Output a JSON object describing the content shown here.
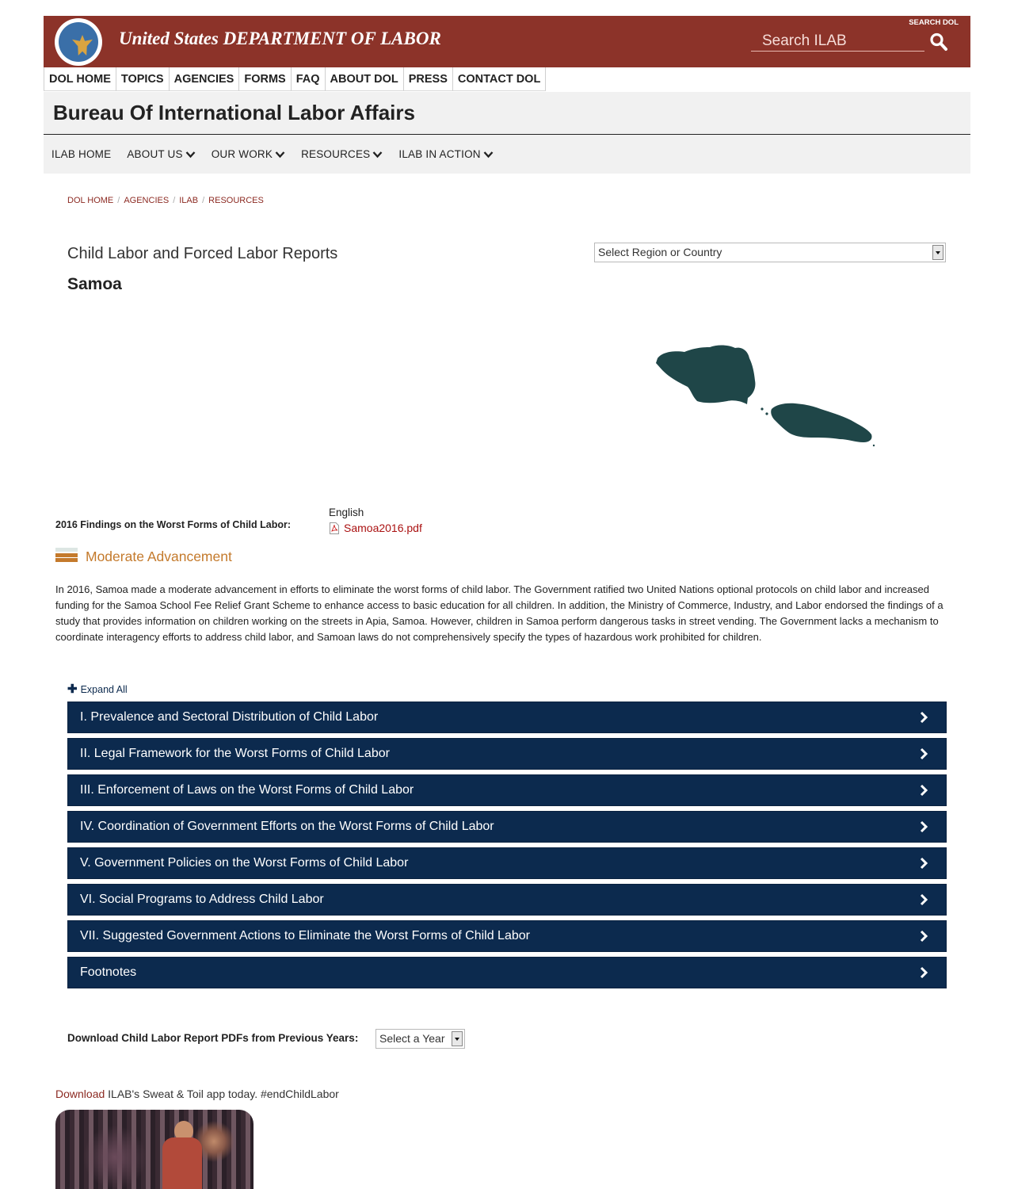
{
  "header": {
    "agency_name": "United States DEPARTMENT OF LABOR",
    "search_dol_label": "SEARCH DOL",
    "search_placeholder": "Search ILAB",
    "brand_color": "#8c3329"
  },
  "top_nav": [
    "DOL HOME",
    "TOPICS",
    "AGENCIES",
    "FORMS",
    "FAQ",
    "ABOUT DOL",
    "PRESS",
    "CONTACT DOL"
  ],
  "bureau_title": "Bureau Of International Labor Affairs",
  "sub_nav": [
    "ILAB HOME",
    "ABOUT US",
    "OUR WORK",
    "RESOURCES",
    "ILAB IN ACTION"
  ],
  "breadcrumb": [
    "DOL HOME",
    "AGENCIES",
    "ILAB",
    "RESOURCES"
  ],
  "page": {
    "title": "Child Labor and Forced Labor Reports",
    "country": "Samoa",
    "region_select": "Select Region or Country",
    "map_color": "#1f4648"
  },
  "findings": {
    "label": "2016 Findings on the Worst Forms of Child Labor:",
    "language": "English",
    "pdf_name": "Samoa2016.pdf"
  },
  "assessment": {
    "label": "Moderate Advancement",
    "color": "#c47a2c"
  },
  "summary": "In 2016, Samoa made a moderate advancement in efforts to eliminate the worst forms of child labor. The Government ratified two United Nations optional protocols on child labor and increased funding for the Samoa School Fee Relief Grant Scheme to enhance access to basic education for all children. In addition, the Ministry of Commerce, Industry, and Labor endorsed the findings of a study that provides information on children working on the streets in Apia, Samoa. However, children in Samoa perform dangerous tasks in street vending. The Government lacks a mechanism to coordinate interagency efforts to address child labor, and Samoan laws do not comprehensively specify the types of hazardous work prohibited for children.",
  "expand_all": "Expand All",
  "sections": [
    "I. Prevalence and Sectoral Distribution of Child Labor",
    "II. Legal Framework for the Worst Forms of Child Labor",
    "III. Enforcement of Laws on the Worst Forms of Child Labor",
    "IV. Coordination of Government Efforts on the Worst Forms of Child Labor",
    "V. Government Policies on the Worst Forms of Child Labor",
    "VI. Social Programs to Address Child Labor",
    "VII. Suggested Government Actions to Eliminate the Worst Forms of Child Labor",
    "Footnotes"
  ],
  "previous_years": {
    "label": "Download Child Labor Report PDFs from Previous Years:",
    "select": "Select a Year"
  },
  "app_promo": {
    "link": "Download",
    "text": " ILAB's Sweat & Toil app today. #endChildLabor"
  },
  "icons": {
    "search": "search-icon",
    "chevron_down": "chevron-down-icon",
    "chevron_right": "chevron-right-icon",
    "pdf": "pdf-icon",
    "plus": "plus-icon"
  }
}
